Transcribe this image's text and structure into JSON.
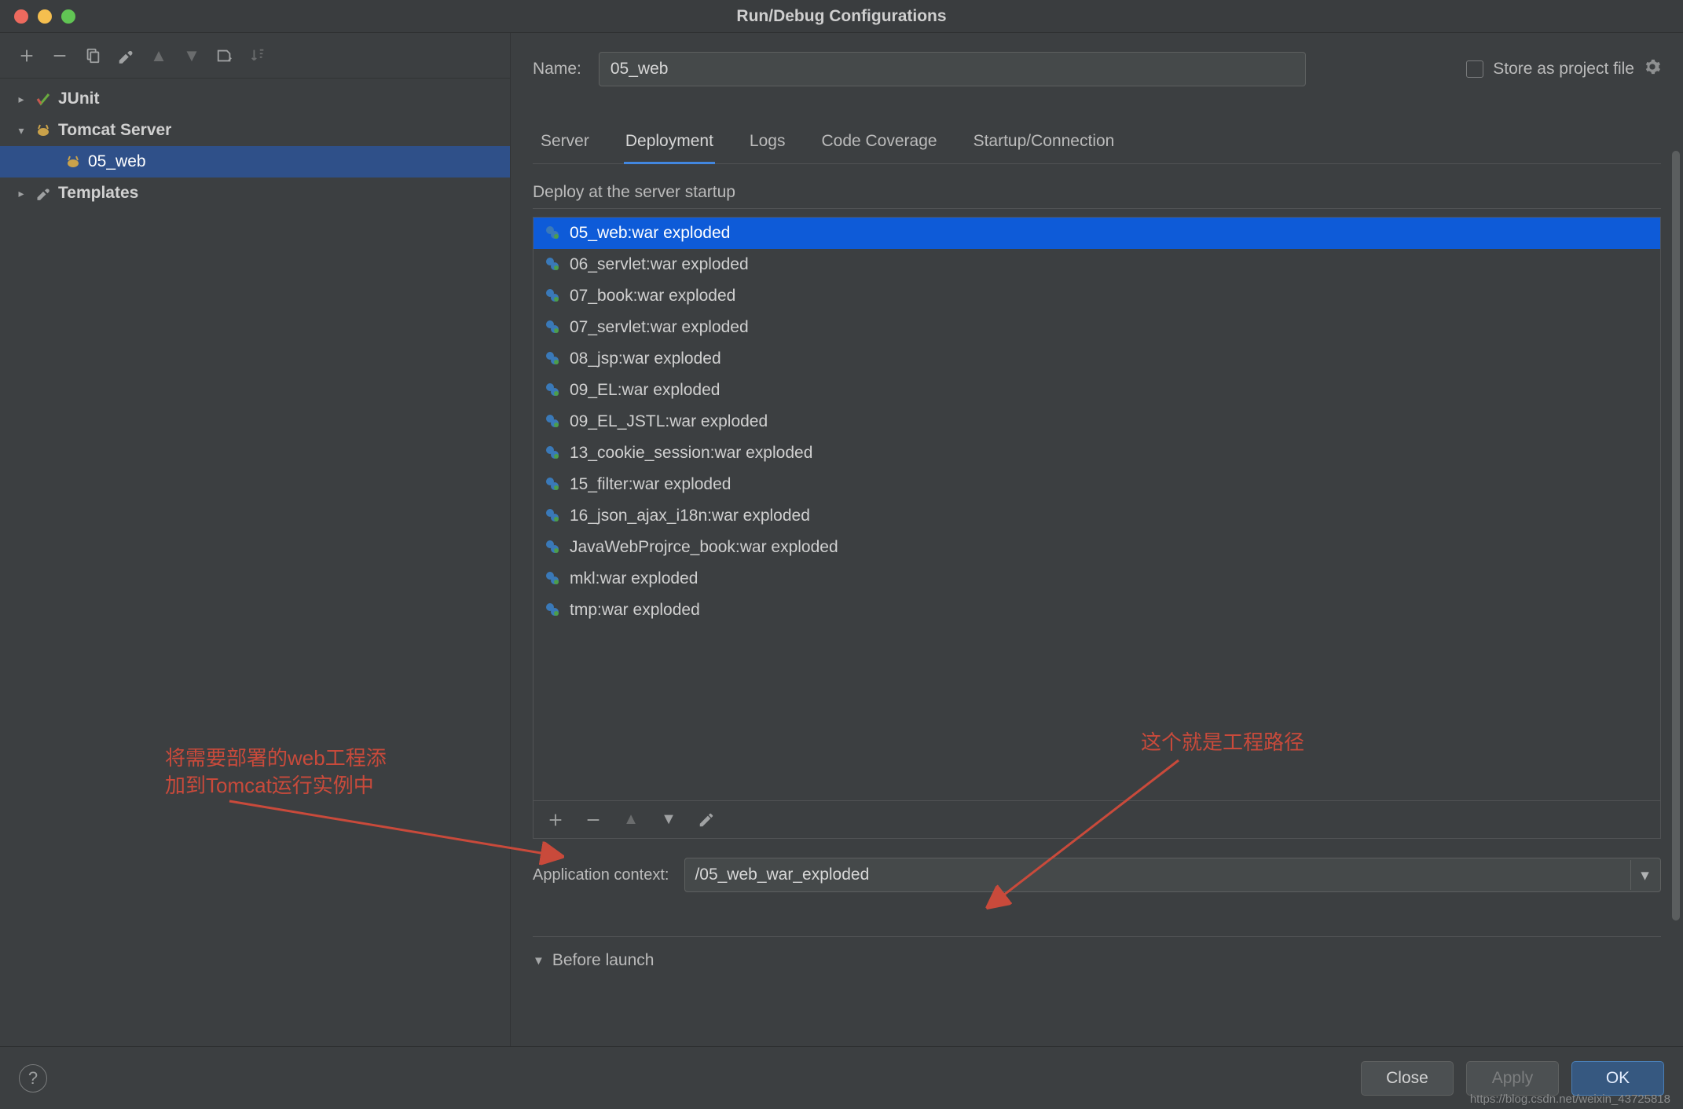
{
  "window": {
    "title": "Run/Debug Configurations"
  },
  "toolbar": {
    "add": "+",
    "remove": "−",
    "copy": "copy",
    "wrench": "wrench",
    "up": "▲",
    "down": "▼",
    "folder": "folder",
    "sort": "sort"
  },
  "tree": {
    "items": [
      {
        "label": "JUnit",
        "icon": "junit",
        "expanded": false,
        "kind": "leaf-group"
      },
      {
        "label": "Tomcat Server",
        "icon": "tomcat",
        "expanded": true,
        "kind": "group",
        "children": [
          {
            "label": "05_web",
            "icon": "tomcat-local",
            "selected": true
          }
        ]
      },
      {
        "label": "Templates",
        "icon": "wrench",
        "expanded": false,
        "kind": "group"
      }
    ]
  },
  "name": {
    "label": "Name:",
    "value": "05_web"
  },
  "store_as_project": {
    "label": "Store as project file",
    "checked": false
  },
  "tabs": [
    {
      "label": "Server",
      "active": false
    },
    {
      "label": "Deployment",
      "active": true
    },
    {
      "label": "Logs",
      "active": false
    },
    {
      "label": "Code Coverage",
      "active": false
    },
    {
      "label": "Startup/Connection",
      "active": false
    }
  ],
  "deploy": {
    "heading": "Deploy at the server startup",
    "items": [
      {
        "label": "05_web:war exploded",
        "selected": true
      },
      {
        "label": "06_servlet:war exploded"
      },
      {
        "label": "07_book:war exploded"
      },
      {
        "label": "07_servlet:war exploded"
      },
      {
        "label": "08_jsp:war exploded"
      },
      {
        "label": "09_EL:war exploded"
      },
      {
        "label": "09_EL_JSTL:war exploded"
      },
      {
        "label": "13_cookie_session:war exploded"
      },
      {
        "label": "15_filter:war exploded"
      },
      {
        "label": "16_json_ajax_i18n:war exploded"
      },
      {
        "label": "JavaWebProjrce_book:war exploded"
      },
      {
        "label": "mkl:war exploded"
      },
      {
        "label": "tmp:war exploded"
      }
    ],
    "toolbar": {
      "add": "+",
      "remove": "−",
      "up": "▲",
      "down": "▼",
      "edit": "edit"
    }
  },
  "app_context": {
    "label": "Application context:",
    "value": "/05_web_war_exploded"
  },
  "before_launch": {
    "label": "Before launch"
  },
  "footer": {
    "close": "Close",
    "apply": "Apply",
    "ok": "OK"
  },
  "annotations": {
    "left": "将需要部署的web工程添\n加到Tomcat运行实例中",
    "right": "这个就是工程路径"
  },
  "watermark": "https://blog.csdn.net/weixin_43725818"
}
